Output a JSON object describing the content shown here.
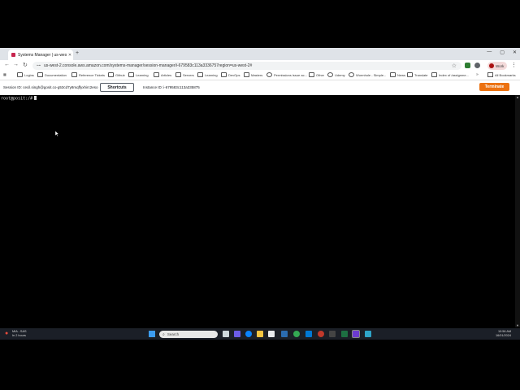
{
  "browser": {
    "tab_title": "Systems Manager | us-west-2",
    "tab_close": "✕",
    "new_tab": "+",
    "window_controls": [
      "—",
      "▢",
      "✕"
    ],
    "nav": {
      "back": "←",
      "forward": "→",
      "reload": "↻"
    },
    "url": "us-west-2.console.aws.amazon.com/systems-manager/session-manager/i-679583c113a3336757region=us-west-2#",
    "profile_label": "Work",
    "bookmarks": [
      "Logins",
      "Documentation",
      "Reference Tickets",
      "Github",
      "Learning",
      "Articles",
      "Servers",
      "Learning",
      "DevOps",
      "Masters",
      "Permissions issue ac...",
      "Other",
      "Udemy",
      "Wormhole - Simple...",
      "News",
      "Translate",
      "Index of /assignme..."
    ],
    "all_bookmarks": "All Bookmarks"
  },
  "session": {
    "session_id_text": "Session ID: cecil.singh@gosit.co-g53cd7y8mqffyxhirc2eso",
    "shortcuts_label": "Shortcuts",
    "instance_id_text": "Instance ID: i-679583c113a335875",
    "terminate_label": "Terminate"
  },
  "terminal": {
    "prompt": "root@posit:/#"
  },
  "taskbar": {
    "weather_line1": "MIA - SAS",
    "weather_line2": "In 2 hours",
    "search_placeholder": "Search",
    "time": "10:56 AM",
    "date": "16/01/2024"
  },
  "colors": {
    "accent_terminate": "#ec7211",
    "terminal_bg": "#000000",
    "taskbar_bg": "#1b1f27"
  }
}
